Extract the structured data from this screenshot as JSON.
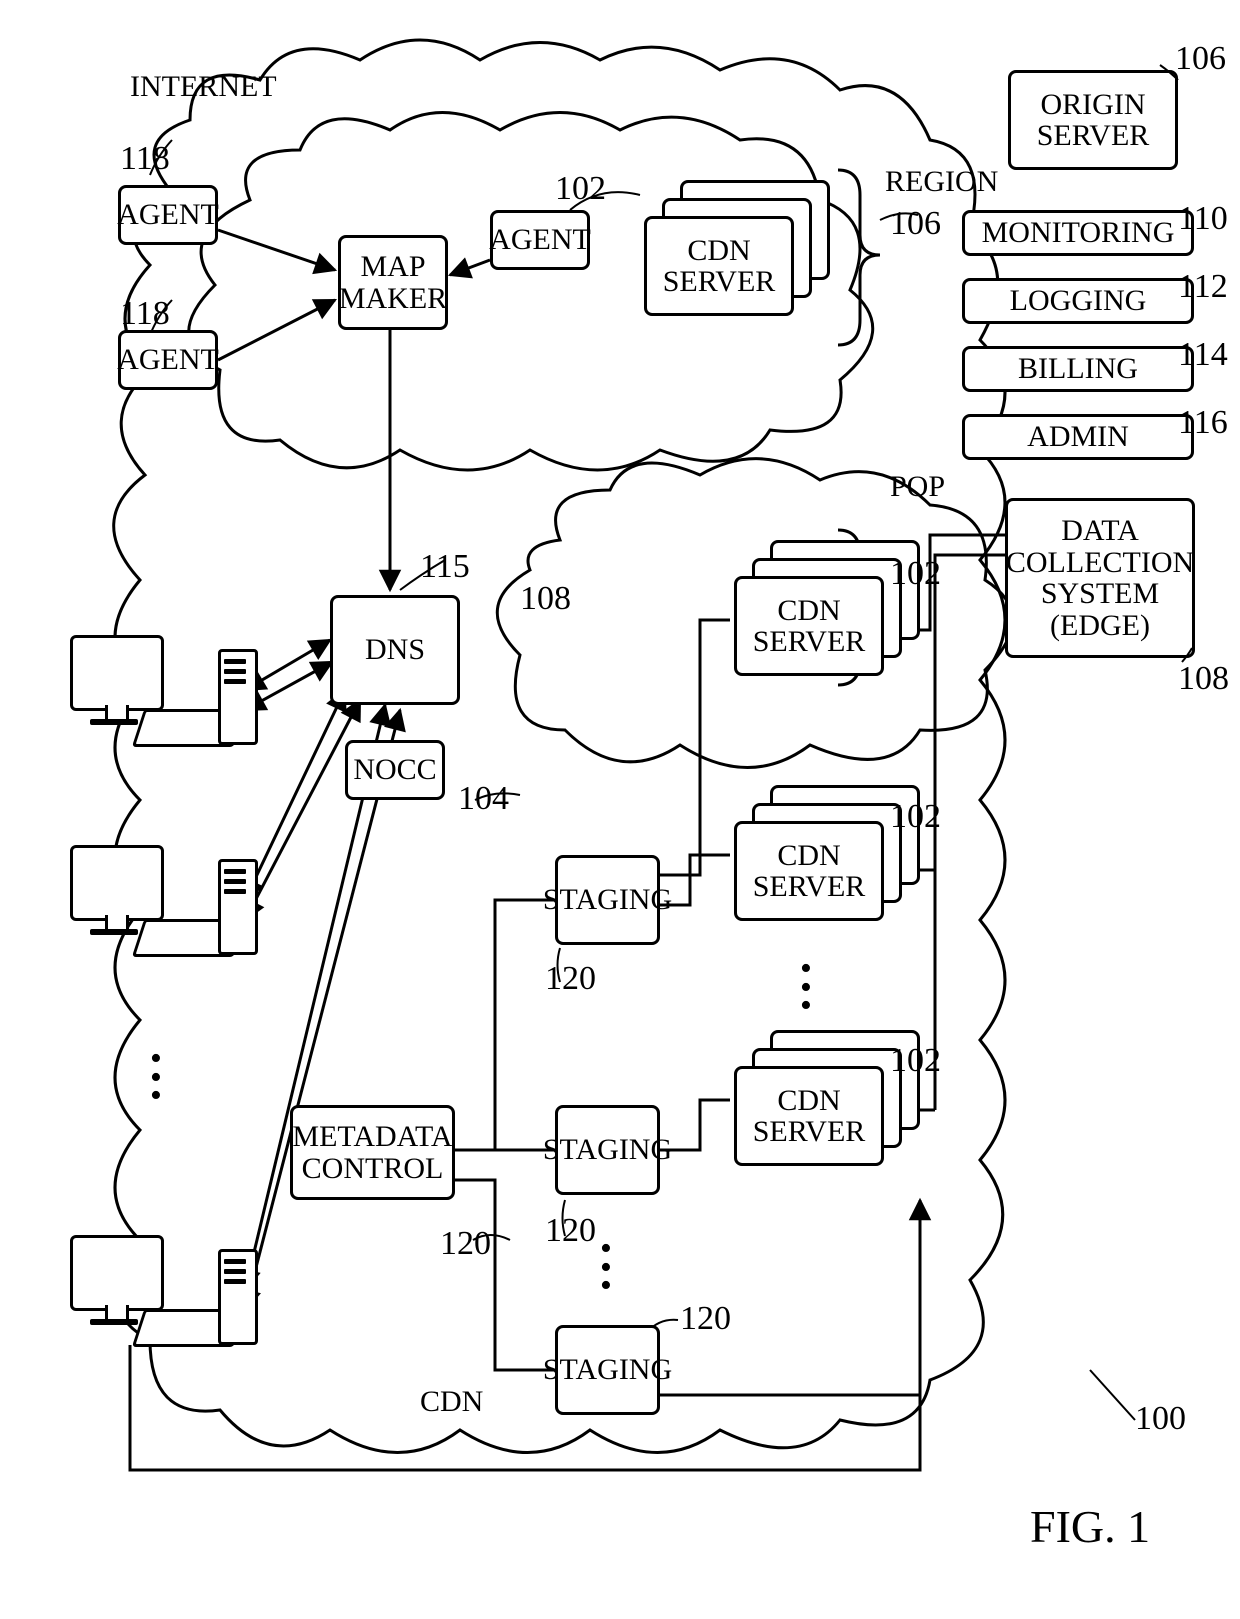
{
  "figure_label": "FIG. 1",
  "labels": {
    "internet": "INTERNET",
    "cdn": "CDN",
    "pop": "POP",
    "region": "REGION"
  },
  "nodes": {
    "origin_server": "ORIGIN\nSERVER",
    "monitoring": "MONITORING",
    "logging": "LOGGING",
    "billing": "BILLING",
    "admin": "ADMIN",
    "dcs": "DATA\nCOLLECTION\nSYSTEM (EDGE)",
    "cdn_server": "CDN\nSERVER",
    "agent": "AGENT",
    "map_maker": "MAP\nMAKER",
    "dns": "DNS",
    "nocc": "NOCC",
    "metadata_control": "METADATA\nCONTROL",
    "staging": "STAGING"
  },
  "refs": {
    "r100": "100",
    "r102": "102",
    "r104": "104",
    "r106": "106",
    "r108": "108",
    "r110": "110",
    "r112": "112",
    "r114": "114",
    "r115": "115",
    "r116": "116",
    "r118": "118",
    "r120": "120"
  }
}
